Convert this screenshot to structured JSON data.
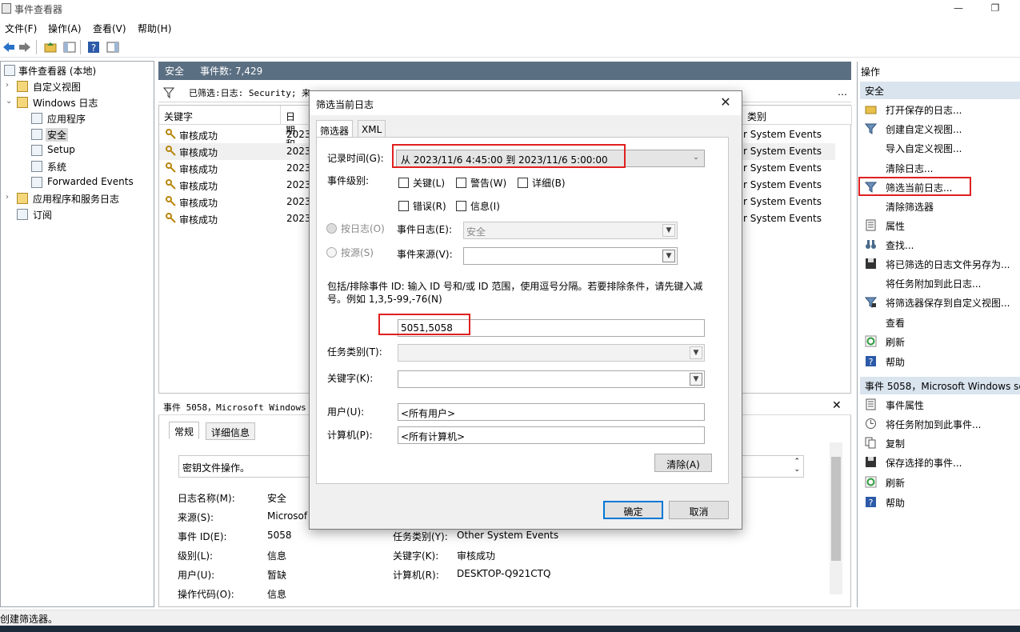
{
  "window": {
    "title": "事件查看器"
  },
  "menu": [
    "文件(F)",
    "操作(A)",
    "查看(V)",
    "帮助(H)"
  ],
  "tree": {
    "root": "事件查看器 (本地)",
    "custom_views": "自定义视图",
    "windows_logs": "Windows 日志",
    "app": "应用程序",
    "security": "安全",
    "setup": "Setup",
    "system": "系统",
    "forwarded": "Forwarded Events",
    "app_services": "应用程序和服务日志",
    "subscriptions": "订阅"
  },
  "center": {
    "header_title": "安全",
    "event_count": "事件数: 7,429",
    "filter_text": "已筛选:日志: Security; 来",
    "filter_tail": "…"
  },
  "grid": {
    "columns": [
      "关键字",
      "日期和",
      "类别"
    ],
    "rows": [
      {
        "keyword": "审核成功",
        "date": "2023",
        "category": "r System Events"
      },
      {
        "keyword": "审核成功",
        "date": "2023",
        "category": "r System Events"
      },
      {
        "keyword": "审核成功",
        "date": "2023",
        "category": "r System Events"
      },
      {
        "keyword": "审核成功",
        "date": "2023",
        "category": "r System Events"
      },
      {
        "keyword": "审核成功",
        "date": "2023",
        "category": "r System Events"
      },
      {
        "keyword": "审核成功",
        "date": "2023",
        "category": "r System Events"
      }
    ]
  },
  "detail": {
    "header": "事件 5058，Microsoft Windows s",
    "tab_general": "常规",
    "tab_details": "详细信息",
    "description": "密钥文件操作。",
    "log_name_label": "日志名称(M):",
    "log_name": "安全",
    "source_label": "来源(S):",
    "source": "Microsof",
    "event_id_label": "事件 ID(E):",
    "event_id": "5058",
    "level_label": "级别(L):",
    "level": "信息",
    "user_label": "用户(U):",
    "user": "暂缺",
    "opcode_label": "操作代码(O):",
    "opcode": "信息",
    "task_label": "任务类别(Y):",
    "task": "Other System Events",
    "keywords_label": "关键字(K):",
    "keywords": "审核成功",
    "computer_label": "计算机(R):",
    "computer": "DESKTOP-Q921CTQ"
  },
  "actions": {
    "header": "操作",
    "section1": "安全",
    "items1": [
      {
        "label": "打开保存的日志...",
        "icon": "folder-icon"
      },
      {
        "label": "创建自定义视图...",
        "icon": "funnel-icon"
      },
      {
        "label": "导入自定义视图...",
        "icon": ""
      },
      {
        "label": "清除日志...",
        "icon": ""
      },
      {
        "label": "筛选当前日志...",
        "icon": "funnel-icon"
      },
      {
        "label": "清除筛选器",
        "icon": ""
      },
      {
        "label": "属性",
        "icon": "properties-icon"
      },
      {
        "label": "查找...",
        "icon": "binoculars-icon"
      },
      {
        "label": "将已筛选的日志文件另存为...",
        "icon": "save-icon"
      },
      {
        "label": "将任务附加到此日志...",
        "icon": ""
      },
      {
        "label": "将筛选器保存到自定义视图...",
        "icon": "funnel-save-icon"
      },
      {
        "label": "查看",
        "icon": ""
      },
      {
        "label": "刷新",
        "icon": "refresh-icon"
      },
      {
        "label": "帮助",
        "icon": "help-icon"
      }
    ],
    "section2": "事件 5058，Microsoft Windows se",
    "items2": [
      {
        "label": "事件属性",
        "icon": "properties-icon"
      },
      {
        "label": "将任务附加到此事件...",
        "icon": "task-icon"
      },
      {
        "label": "复制",
        "icon": "copy-icon"
      },
      {
        "label": "保存选择的事件...",
        "icon": "save-icon"
      },
      {
        "label": "刷新",
        "icon": "refresh-icon"
      },
      {
        "label": "帮助",
        "icon": "help-icon"
      }
    ]
  },
  "status": "创建筛选器。",
  "dialog": {
    "title": "筛选当前日志",
    "tab_filter": "筛选器",
    "tab_xml": "XML",
    "logged_label": "记录时间(G):",
    "logged_value": "从 2023/11/6 4:45:00 到 2023/11/6 5:00:00",
    "level_label": "事件级别:",
    "critical": "关键(L)",
    "warning": "警告(W)",
    "verbose": "详细(B)",
    "error": "错误(R)",
    "info": "信息(I)",
    "by_log": "按日志(O)",
    "by_source": "按源(S)",
    "event_logs_label": "事件日志(E):",
    "event_logs_value": "安全",
    "event_sources_label": "事件来源(V):",
    "id_hint": "包括/排除事件 ID: 输入 ID 号和/或 ID 范围，使用逗号分隔。若要排除条件，请先键入减号。例如 1,3,5-99,-76(N)",
    "event_ids": "5051,5058",
    "task_label": "任务类别(T):",
    "keywords_label": "关键字(K):",
    "user_label": "用户(U):",
    "user_value": "<所有用户>",
    "computer_label": "计算机(P):",
    "computer_value": "<所有计算机>",
    "clear_btn": "清除(A)",
    "ok_btn": "确定",
    "cancel_btn": "取消"
  },
  "colors": {
    "accent": "#0078d7",
    "highlight": "#e02020",
    "section_bg": "#d9e4ef",
    "header_bg": "#5b6f82"
  }
}
